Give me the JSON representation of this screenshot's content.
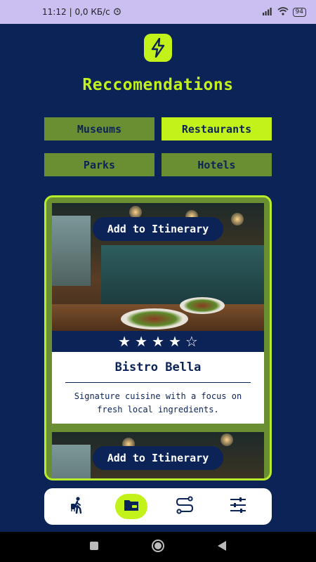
{
  "status_bar": {
    "time": "11:12",
    "network": "| 0,0 КБ/с",
    "battery": "94",
    "icons": [
      "alarm-icon",
      "signal-icon",
      "wifi-icon",
      "battery-icon"
    ]
  },
  "header": {
    "logo_icon": "lightning-bolt-icon",
    "title": "Reccomendations"
  },
  "categories": [
    {
      "label": "Museums",
      "active": false
    },
    {
      "label": "Restaurants",
      "active": true
    },
    {
      "label": "Parks",
      "active": false
    },
    {
      "label": "Hotels",
      "active": false
    }
  ],
  "cards": [
    {
      "add_label": "Add to Itinerary",
      "rating": 4,
      "rating_max": 5,
      "name": "Bistro Bella",
      "description": "Signature cuisine with a focus on fresh local ingredients."
    },
    {
      "add_label": "Add to Itinerary"
    }
  ],
  "bottom_nav": [
    {
      "icon": "traveler-icon",
      "active": false
    },
    {
      "icon": "wallet-icon",
      "active": true
    },
    {
      "icon": "route-icon",
      "active": false
    },
    {
      "icon": "sliders-icon",
      "active": false
    }
  ],
  "system_nav": [
    "recents-square-icon",
    "home-circle-icon",
    "back-triangle-icon"
  ],
  "colors": {
    "background": "#0c2358",
    "accent": "#c3f11a",
    "category_inactive": "#6a8f33",
    "status_bar": "#cabff0"
  }
}
